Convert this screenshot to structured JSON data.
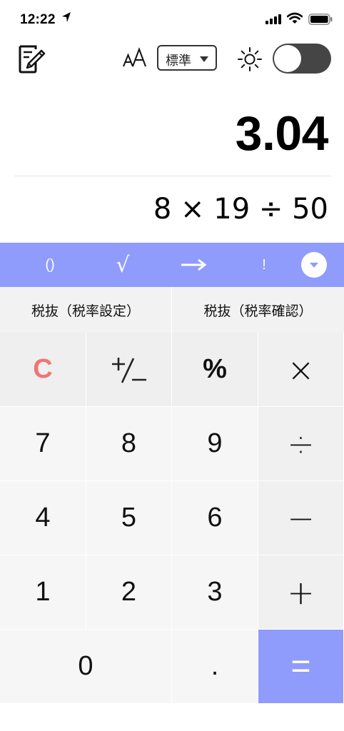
{
  "status_bar": {
    "time": "12:22"
  },
  "toolbar": {
    "mode_label": "標準",
    "theme_toggle": "off"
  },
  "display": {
    "result": "3.04",
    "expression": "8 × 19 ÷ 50"
  },
  "function_bar": {
    "paren": "()",
    "sqrt": "√",
    "fact": "!"
  },
  "tax_buttons": {
    "tax_excluded_set": "税抜（税率設定）",
    "tax_excluded_check": "税抜（税率確認）"
  },
  "keys": {
    "clear": "C",
    "sign": "+/−",
    "percent": "%",
    "multiply": "×",
    "k7": "7",
    "k8": "8",
    "k9": "9",
    "divide": "÷",
    "k4": "4",
    "k5": "5",
    "k6": "6",
    "minus": "−",
    "k1": "1",
    "k2": "2",
    "k3": "3",
    "plus": "+",
    "k0": "0",
    "dot": ".",
    "equals": "="
  },
  "colors": {
    "accent": "#8f9cfb",
    "clear": "#f07575",
    "toggle_track": "#454545"
  }
}
